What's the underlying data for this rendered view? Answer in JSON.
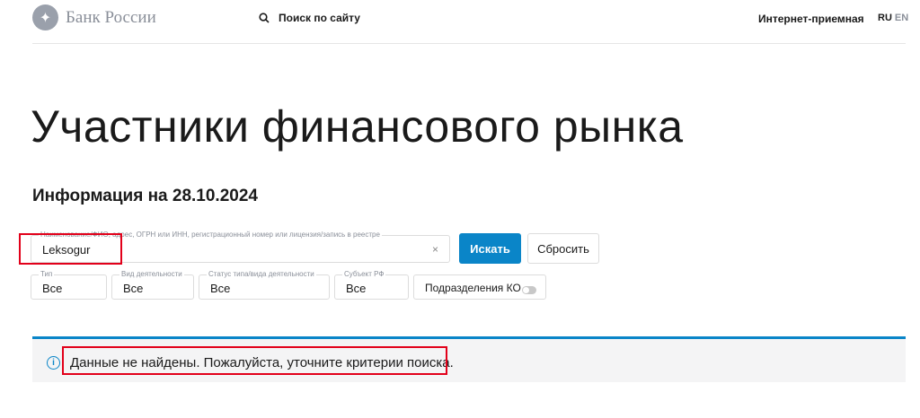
{
  "header": {
    "logo_text": "Банк России",
    "search_label": "Поиск по сайту",
    "reception": "Интернет-приемная",
    "lang_ru": "RU",
    "lang_en": "EN"
  },
  "page": {
    "title": "Участники финансового рынка",
    "subtitle": "Информация на 28.10.2024"
  },
  "search_form": {
    "query_label": "Наименование/ФИО, адрес, ОГРН или ИНН, регистрационный номер или лицензия/запись в реестре",
    "query_value": "Leksogur",
    "clear": "×",
    "search_button": "Искать",
    "reset_button": "Сбросить",
    "filters": [
      {
        "label": "Тип",
        "value": "Все"
      },
      {
        "label": "Вид деятельности",
        "value": "Все"
      },
      {
        "label": "Статус типа/вида деятельности",
        "value": "Все"
      },
      {
        "label": "Субъект РФ",
        "value": "Все"
      }
    ],
    "ko_toggle": {
      "label": "Подразделения КО",
      "on": false
    }
  },
  "alert": {
    "icon": "i",
    "text": "Данные не найдены. Пожалуйста, уточните критерии поиска."
  }
}
